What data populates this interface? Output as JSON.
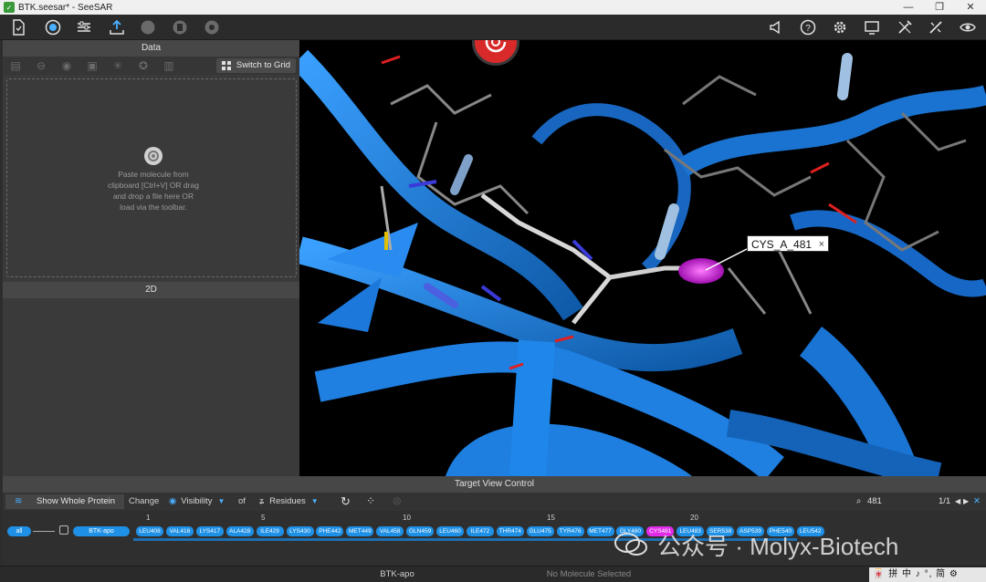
{
  "window": {
    "title": "BTK.seesar* - SeeSAR",
    "controls": [
      "—",
      "❐",
      "✕"
    ]
  },
  "toolbar": {
    "icons": [
      "document-icon",
      "analyzer-icon",
      "settings-sliders-icon",
      "upload-icon",
      "mode-icon-1",
      "mode-icon-2",
      "mode-icon-3",
      "announce-icon",
      "help-icon",
      "gear-icon",
      "screen-icon",
      "tools-icon",
      "link-tools-icon",
      "eye-icon"
    ]
  },
  "data_panel": {
    "title": "Data",
    "switch_label": "Switch to Grid",
    "drop_text": "Paste molecule from\nclipboard [Ctrl+V] OR drag\nand drop a file here OR\nload via the toolbar.",
    "section_2d": "2D"
  },
  "view3d": {
    "label": "CYS_A_481",
    "label_close": "×",
    "colors": {
      "ribbon": "#1e7fe0",
      "highlight": "#d020d8",
      "background": "#000000"
    }
  },
  "target_view_control": {
    "title": "Target View Control",
    "show_whole_protein": "Show Whole Protein",
    "change": "Change",
    "visibility": "Visibility",
    "of": "of",
    "residues": "Residues",
    "search_value": "481",
    "search_count": "1/1",
    "chain_all": "all",
    "chain_name": "BTK-apo",
    "ruler": [
      "1",
      "5",
      "10",
      "15",
      "20"
    ],
    "residues_list": [
      "LEU408",
      "VAL416",
      "LYS417",
      "ALA428",
      "ILE429",
      "LYS430",
      "PHE442",
      "MET449",
      "VAL458",
      "GLN459",
      "LEU460",
      "ILE472",
      "THR474",
      "GLU475",
      "TYR476",
      "MET477",
      "GLY480",
      "CYS481",
      "LEU483",
      "SER538",
      "ASP539",
      "PHE540",
      "LEU542"
    ],
    "selected_residue": "CYS481"
  },
  "watermark": {
    "text": "公众号 · Molyx-Biotech"
  },
  "statusbar": {
    "left": "BTK-apo",
    "right": "No Molecule Selected",
    "ime": "🀄 拼 中 ♪ °, 简 ⚙"
  }
}
